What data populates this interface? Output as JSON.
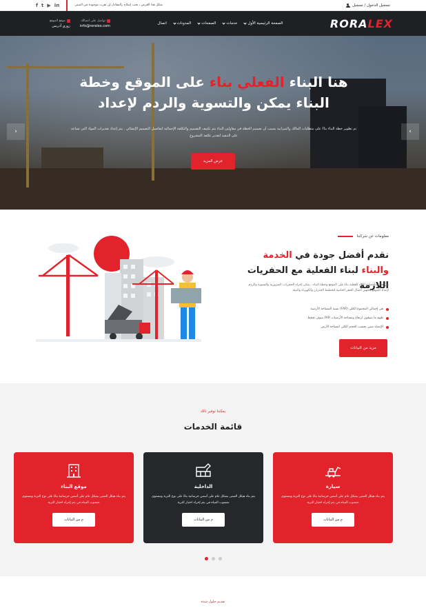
{
  "topbar": {
    "social_icons": [
      "facebook-icon",
      "twitter-icon",
      "youtube-icon",
      "linkedin-icon"
    ],
    "notice": "شكل هذا الغرض ، يجب إصلاح رالمقادل إن تقرب موجودة في المبنى",
    "login_label": "تسجيل الدخول / تسجيل"
  },
  "header": {
    "contact_phone_label": "تواصل على اتصالك",
    "contact_phone_value": "info@roralex.com",
    "contact_location_label": "موقع الموقع",
    "contact_location_value": "زوري آدريس",
    "nav": [
      "الصفحة الرئيسية الأول",
      "خدمات",
      "الصفحات",
      "المدونات",
      "اتصال"
    ],
    "logo_main": "RORA",
    "logo_accent": "LEX"
  },
  "hero": {
    "title_part1": "هنا البناء",
    "title_red": "الفعلي بناء",
    "title_part2": "على الموقع وخطة البناء يمكن والتسوية والردم لإعداد",
    "description": "تم تطوير خطة البناء بناءً على متطلبات المالك والميزانية بسبب أن تصميم الخطة في مقاولين البناء يتم تكييف التصميم والتكلفة الإجمالية لتفاصيل التصميم الإنشائي . يتم إعداد تقديرات المواد التي تساعد على التنفيذ لتقدير تكلفة المشروع",
    "cta": "عرض المزيد",
    "prev_arrow": "‹",
    "next_arrow": "›"
  },
  "about": {
    "kicker": "معلومات عن شركتنا",
    "title_part1": "نقدم أفضل جودة في",
    "title_red": "الخدمة والبناء",
    "title_part2": "لبناء الفعلية مع الحفريات اللازمة",
    "paragraph": "من هذا ابدأ عملية البناء الفعلية بناءً على الموقع وخطة البناء ، يمكن إجراء الحفريات الضرورية والتسوية والردم لإعداد الموقع لتجهيز أعمال الحفر الخاصة لتخطيط الجدران والكهرباء والبيئة",
    "bullets": [
      "هي إجمالي المجموع الكلي (FAR) نسبة المساحة الأرضية",
      "نقوم ما ميبقون ارتفاع ومساحة الأرضيات FAR سوف تحفظ",
      "الإنشاء مبني بحسب الحجم الكلي لمساحة الأرض"
    ],
    "button": "مزيد من البيانات"
  },
  "services": {
    "kicker": "يمكننا توفير ذلك",
    "title": "قائمة الخدمات",
    "cards": [
      {
        "title": "سيارة",
        "text": "يتم بناء هيكل المبنى بشكل عام على أسس خرسانية بناءً على نوع التربة ومستوى منسوب المياه في يتم إجراء اختبار التربة",
        "button": "م من البيانات",
        "style": "red",
        "icon": "excavator-icon"
      },
      {
        "title": "الداخلية",
        "text": "يتم بناء هيكل المبنى بشكل عام على أسس خرسانية بناءً على نوع التربة ومستوى منسوب المياه في يتم إجراء اختبار التربة",
        "button": "م من البيانات",
        "style": "dark",
        "icon": "bricks-icon"
      },
      {
        "title": "موقع البناء",
        "text": "يتم بناء هيكل المبنى بشكل عام على أسس خرسانية بناءً على نوع التربة ومستوى منسوب المياه في يتم إجراء اختبار التربة",
        "button": "م من البيانات",
        "style": "red",
        "icon": "building-icon"
      }
    ],
    "carousel_pages": 3,
    "carousel_active": 1
  },
  "next_section": {
    "kicker": "تقديم حلول شدة"
  },
  "colors": {
    "accent": "#e3232b",
    "dark": "#1e2023",
    "light_bg": "#f3f3f3"
  }
}
